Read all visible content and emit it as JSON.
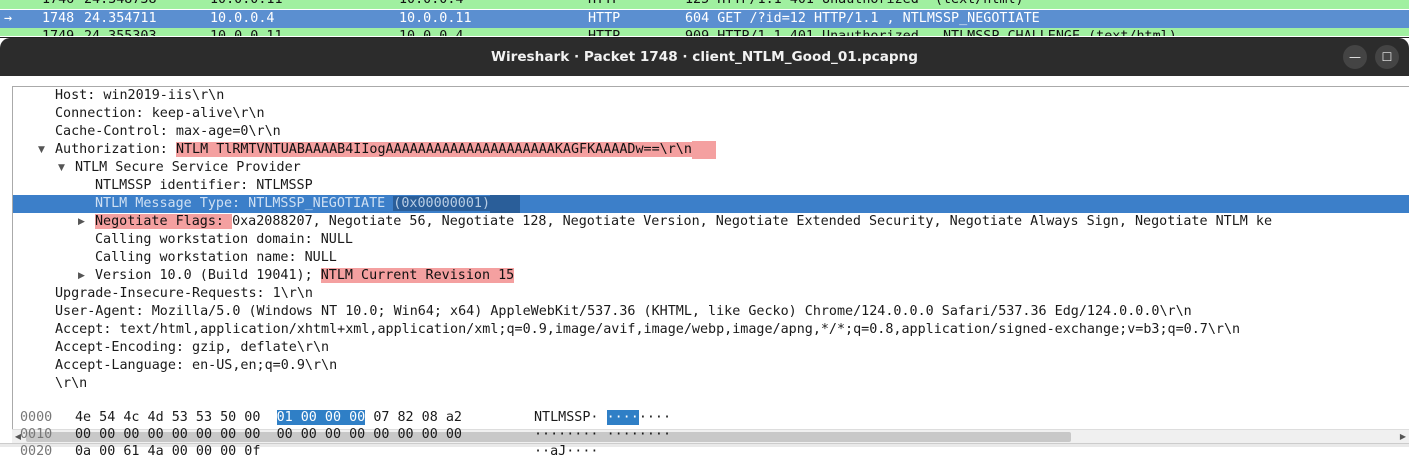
{
  "packet_list": {
    "rows": [
      {
        "no": "1746",
        "time": "24.348738",
        "src": "10.0.0.11",
        "dst": "10.0.0.4",
        "proto": "HTTP",
        "info": "125 HTTP/1.1 401 Unauthorized  (text/html)"
      },
      {
        "no": "1748",
        "time": "24.354711",
        "src": "10.0.0.4",
        "dst": "10.0.0.11",
        "proto": "HTTP",
        "info": "604 GET /?id=12 HTTP/1.1 , NTLMSSP_NEGOTIATE"
      },
      {
        "no": "1749",
        "time": "24.355303",
        "src": "10.0.0.11",
        "dst": "10.0.0.4",
        "proto": "HTTP",
        "info": "909 HTTP/1.1 401 Unauthorized , NTLMSSP_CHALLENGE (text/html)"
      }
    ]
  },
  "window": {
    "title": "Wireshark · Packet 1748 · client_NTLM_Good_01.pcapng",
    "minimize_glyph": "—",
    "close_glyph": "☐"
  },
  "tree": {
    "host": "Host: win2019-iis\\r\\n",
    "connection": "Connection: keep-alive\\r\\n",
    "cache_control": "Cache-Control: max-age=0\\r\\n",
    "authorization_label": "Authorization: ",
    "authorization_value": "NTLM TlRMTVNTUABAAAAB4IIogAAAAAAAAAAAAAAAAAAAAAKAGFKAAAADw==\\r\\n",
    "ntlm_provider": "NTLM Secure Service Provider",
    "ntlmssp_identifier": "NTLMSSP identifier: NTLMSSP",
    "message_type_label": "NTLM Message Type: NTLMSSP_NEGOTIATE ",
    "message_type_value": "(0x00000001)",
    "negotiate_flags_label": "Negotiate Flags: ",
    "negotiate_flags_value": "0xa2088207, Negotiate 56, Negotiate 128, Negotiate Version, Negotiate Extended Security, Negotiate Always Sign, Negotiate NTLM ke",
    "calling_domain": "Calling workstation domain: NULL",
    "calling_name": "Calling workstation name: NULL",
    "version_label": "Version 10.0 (Build 19041); ",
    "version_revision": "NTLM Current Revision 15",
    "upgrade": "Upgrade-Insecure-Requests: 1\\r\\n",
    "user_agent": "User-Agent: Mozilla/5.0 (Windows NT 10.0; Win64; x64) AppleWebKit/537.36 (KHTML, like Gecko) Chrome/124.0.0.0 Safari/537.36 Edg/124.0.0.0\\r\\n",
    "accept": "Accept: text/html,application/xhtml+xml,application/xml;q=0.9,image/avif,image/webp,image/apng,*/*;q=0.8,application/signed-exchange;v=b3;q=0.7\\r\\n",
    "accept_encoding": "Accept-Encoding: gzip, deflate\\r\\n",
    "accept_language": "Accept-Language: en-US,en;q=0.9\\r\\n",
    "crlf": "\\r\\n"
  },
  "hex": {
    "rows": [
      {
        "offset": "0000",
        "bytes_a": "4e 54 4c 4d 53 53 50 00",
        "bytes_sel": "01 00 00 00",
        "bytes_b": "07 82 08 a2",
        "ascii_a": "NTLMSSP·",
        "ascii_sel": "····",
        "ascii_b": "····"
      },
      {
        "offset": "0010",
        "bytes_a": "00 00 00 00 00 00 00 00",
        "bytes_sel": "",
        "bytes_b": "00 00 00 00 00 00 00 00",
        "ascii_a": "········",
        "ascii_sel": "",
        "ascii_b": "········"
      },
      {
        "offset": "0020",
        "bytes_a": "0a 00 61 4a 00 00 00 0f",
        "bytes_sel": "",
        "bytes_b": "",
        "ascii_a": "··aJ····",
        "ascii_sel": "",
        "ascii_b": ""
      }
    ]
  },
  "colors": {
    "highlight_red": "#f4a0a0",
    "selection_blue": "#3c7fc9",
    "packet_green": "#a0f0a0",
    "packet_selected": "#5b8fd0",
    "titlebar": "#2c2c2c"
  }
}
